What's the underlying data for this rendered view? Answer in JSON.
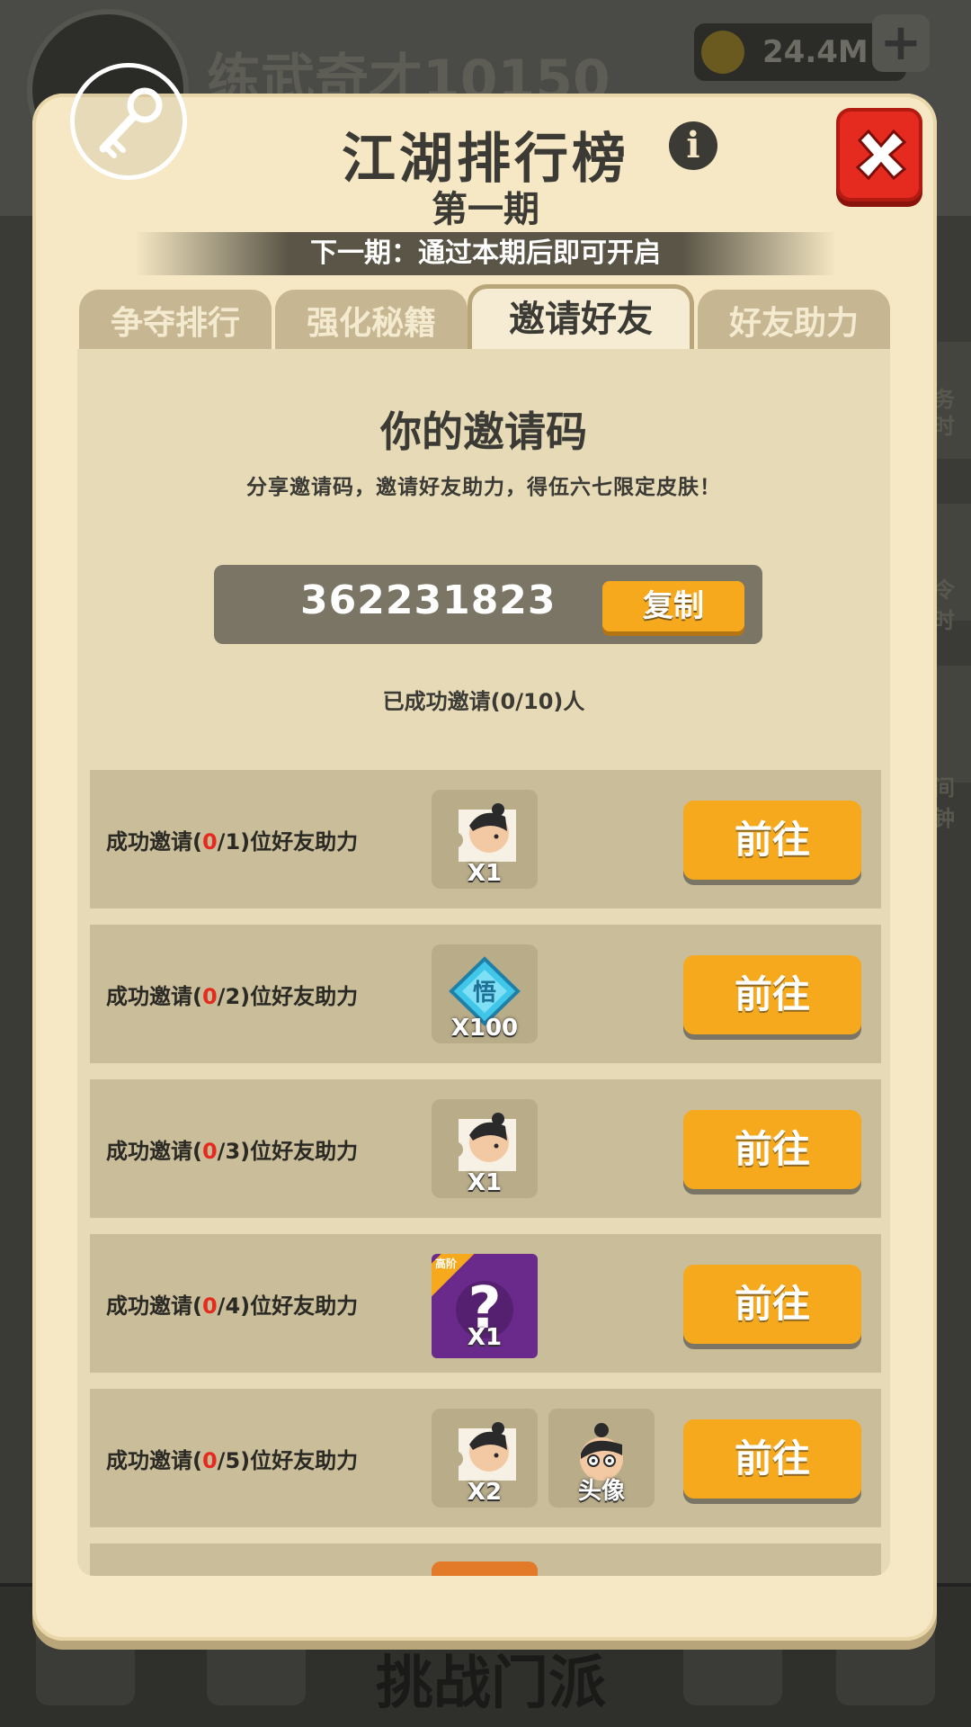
{
  "background": {
    "player_name": "练武奇才10150",
    "coin_value": "24.4M",
    "bottom_title": "挑战门派",
    "side_labels": [
      "务",
      "时",
      "令",
      "时",
      "间",
      "钟"
    ]
  },
  "modal": {
    "title": "江湖排行榜",
    "subtitle": "第一期",
    "next_period": "下一期：通过本期后即可开启",
    "tabs": [
      {
        "label": "争夺排行"
      },
      {
        "label": "强化秘籍"
      },
      {
        "label": "邀请好友"
      },
      {
        "label": "好友助力"
      }
    ],
    "active_tab": "邀请好友"
  },
  "invite": {
    "heading": "你的邀请码",
    "description": "分享邀请码，邀请好友助力，得伍六七限定皮肤！",
    "code": "362231823",
    "copy_label": "复制",
    "invited_count": "已成功邀请(0/10)人"
  },
  "tasks": [
    {
      "prefix": "成功邀请(",
      "current": "0",
      "suffix": "/1)位好友助力",
      "rewards": [
        {
          "type": "character-fragment",
          "label": "X1"
        }
      ],
      "button": "前往"
    },
    {
      "prefix": "成功邀请(",
      "current": "0",
      "suffix": "/2)位好友助力",
      "rewards": [
        {
          "type": "insight-gem",
          "label": "X100",
          "glyph": "悟"
        }
      ],
      "button": "前往"
    },
    {
      "prefix": "成功邀请(",
      "current": "0",
      "suffix": "/3)位好友助力",
      "rewards": [
        {
          "type": "character-fragment",
          "label": "X1"
        }
      ],
      "button": "前往"
    },
    {
      "prefix": "成功邀请(",
      "current": "0",
      "suffix": "/4)位好友助力",
      "rewards": [
        {
          "type": "mystery-box",
          "label": "X1",
          "tag": "高阶"
        }
      ],
      "button": "前往"
    },
    {
      "prefix": "成功邀请(",
      "current": "0",
      "suffix": "/5)位好友助力",
      "rewards": [
        {
          "type": "character-fragment",
          "label": "X2"
        },
        {
          "type": "avatar-frame",
          "label": "头像"
        }
      ],
      "button": "前往"
    }
  ],
  "colors": {
    "panel": "#f6e8c4",
    "accent_orange": "#f7a91d",
    "close_red": "#e52a1f",
    "progress_red": "#e52a1f",
    "row_bg": "#c9bd9a"
  }
}
